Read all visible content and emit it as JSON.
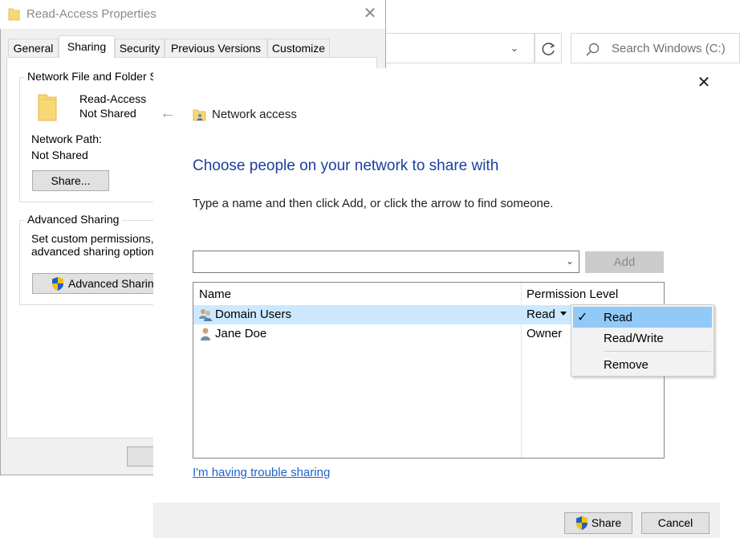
{
  "explorer": {
    "search_placeholder": "Search Windows (C:)"
  },
  "properties": {
    "title": "Read-Access Properties",
    "tabs": [
      "General",
      "Sharing",
      "Security",
      "Previous Versions",
      "Customize"
    ],
    "active_tab": "Sharing",
    "network_group_label": "Network File and Folder Sh",
    "folder_name": "Read-Access",
    "folder_status": "Not Shared",
    "network_path_label": "Network Path:",
    "network_path_value": "Not Shared",
    "share_button": "Share...",
    "advanced_group_label": "Advanced Sharing",
    "advanced_desc_line1": "Set custom permissions, c",
    "advanced_desc_line2": "advanced sharing options",
    "advanced_button": "Advanced Sharing"
  },
  "network_access": {
    "title": "Network access",
    "heading": "Choose people on your network to share with",
    "instruction": "Type a name and then click Add, or click the arrow to find someone.",
    "name_input_value": "",
    "add_button": "Add",
    "columns": {
      "name": "Name",
      "permission": "Permission Level"
    },
    "rows": [
      {
        "name": "Domain Users",
        "permission": "Read",
        "selected": true
      },
      {
        "name": "Jane Doe",
        "permission": "Owner",
        "selected": false
      }
    ],
    "permission_menu": {
      "items": [
        "Read",
        "Read/Write",
        "Remove"
      ],
      "checked": "Read"
    },
    "trouble_link": "I'm having trouble sharing",
    "share_button": "Share",
    "cancel_button": "Cancel"
  },
  "colors": {
    "heading_blue": "#1b3f9d",
    "link_blue": "#1c63c9",
    "selection": "#cce8ff",
    "menu_highlight": "#91c9f7",
    "folder_yellow": "#f8d775",
    "shield_blue": "#1f5fbf",
    "shield_yellow": "#f5c400"
  }
}
